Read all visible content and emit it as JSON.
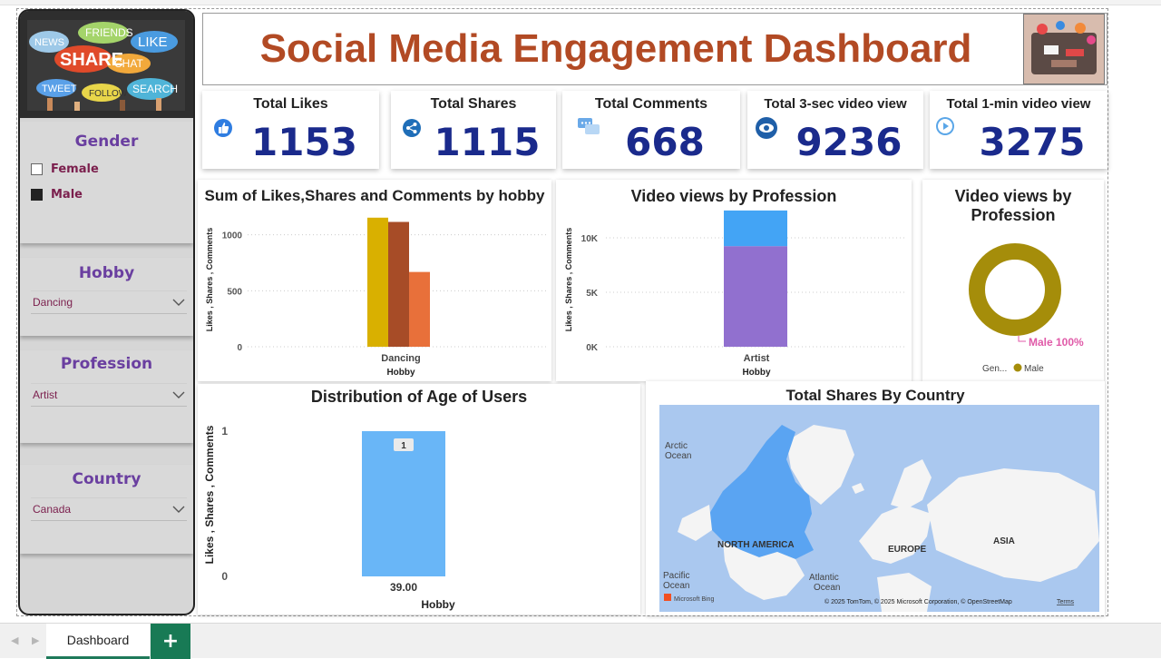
{
  "title": "Social Media Engagement Dashboard",
  "filters": {
    "gender": {
      "title": "Gender",
      "options": [
        {
          "label": "Female",
          "checked": false
        },
        {
          "label": "Male",
          "checked": true
        }
      ]
    },
    "hobby": {
      "title": "Hobby",
      "value": "Dancing"
    },
    "profession": {
      "title": "Profession",
      "value": "Artist"
    },
    "country": {
      "title": "Country",
      "value": "Canada"
    }
  },
  "logo_words": [
    "NEWS",
    "FRIENDS",
    "LIKE",
    "SHARE",
    "CHAT",
    "TWEET",
    "FOLLOW",
    "SEARCH"
  ],
  "kpis": [
    {
      "label": "Total Likes",
      "value": "1153",
      "icon": "thumbs-up-icon"
    },
    {
      "label": "Total Shares",
      "value": "1115",
      "icon": "share-icon"
    },
    {
      "label": "Total Comments",
      "value": "668",
      "icon": "comment-icon"
    },
    {
      "label": "Total 3-sec video view",
      "value": "9236",
      "icon": "eye-icon"
    },
    {
      "label": "Total 1-min video view",
      "value": "3275",
      "icon": "play-icon"
    }
  ],
  "colors": {
    "likes": "#d9b000",
    "shares": "#a74c27",
    "comments": "#e8703a",
    "view3": "#9170cf",
    "view1": "#43a4f5",
    "donut": "#a58d0a",
    "age_bar": "#69b6f7",
    "kpi_value": "#1a2a8c",
    "title": "#b24a24",
    "filter_title": "#6a3fa0"
  },
  "chart_data": [
    {
      "type": "bar",
      "title": "Sum of Likes,Shares and Comments by hobby",
      "xlabel": "Hobby",
      "ylabel": "Likes , Shares , Comments",
      "categories": [
        "Dancing"
      ],
      "series": [
        {
          "values": [
            1153
          ]
        },
        {
          "values": [
            1115
          ]
        },
        {
          "values": [
            668
          ]
        }
      ],
      "ylim": [
        0,
        1200
      ],
      "yticks": [
        "0",
        "500",
        "1000"
      ],
      "grid": true
    },
    {
      "type": "bar",
      "stacked": true,
      "title": "Video views by Profession",
      "xlabel": "Hobby",
      "ylabel": "Likes , Shares , Comments",
      "categories": [
        "Artist"
      ],
      "series": [
        {
          "values": [
            9236
          ]
        },
        {
          "values": [
            3275
          ]
        }
      ],
      "ylim": [
        0,
        13000
      ],
      "yticks": [
        "0K",
        "5K",
        "10K"
      ],
      "grid": true
    },
    {
      "type": "pie",
      "donut": true,
      "title": "Video views by Profession",
      "slices": [
        {
          "label": "Male",
          "value": 100,
          "data_label": "Male 100%"
        }
      ],
      "legend_title": "Gen...",
      "legend": [
        "Male"
      ]
    },
    {
      "type": "bar",
      "title": "Distribution of Age of Users",
      "xlabel": "Hobby",
      "ylabel": "Likes , Shares , Comments",
      "categories": [
        "39.00"
      ],
      "values": [
        1
      ],
      "data_labels": [
        "1"
      ],
      "ylim": [
        0,
        1
      ],
      "yticks": [
        "0",
        "1"
      ],
      "grid": false
    }
  ],
  "map": {
    "title": "Total Shares By Country",
    "labels": {
      "arctic": "Arctic\nOcean",
      "arctic_1": "Arctic",
      "arctic_2": "Ocean",
      "north_america": "NORTH AMERICA",
      "europe": "EUROPE",
      "asia": "ASIA",
      "pacific_1": "Pacific",
      "pacific_2": "Ocean",
      "atlantic_1": "Atlantic",
      "atlantic_2": "Ocean"
    },
    "attribution": "© 2025 TomTom, © 2025 Microsoft Corporation, © OpenStreetMap",
    "terms": "Terms",
    "brand": "Microsoft Bing"
  },
  "tabs": [
    {
      "label": "Dashboard",
      "active": true
    }
  ],
  "add_tab_label": "+"
}
